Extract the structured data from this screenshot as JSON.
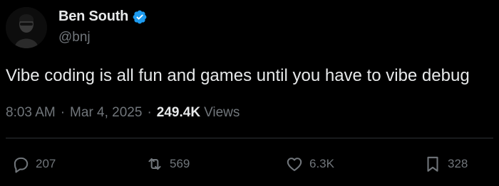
{
  "author": {
    "display_name": "Ben South",
    "handle": "@bnj",
    "verified_icon": "verified-badge-icon",
    "verified_color": "#1d9bf0",
    "avatar_icon": "avatar"
  },
  "post": {
    "text": "Vibe coding is all fun and games until you have to vibe debug"
  },
  "meta": {
    "time": "8:03 AM",
    "date": "Mar 4, 2025",
    "separator": "·",
    "views_count": "249.4K",
    "views_label": "Views"
  },
  "actions": {
    "reply": {
      "icon": "reply-icon",
      "count": "207"
    },
    "repost": {
      "icon": "repost-icon",
      "count": "569"
    },
    "like": {
      "icon": "heart-icon",
      "count": "6.3K"
    },
    "bookmark": {
      "icon": "bookmark-icon",
      "count": "328"
    }
  },
  "colors": {
    "background": "#000000",
    "primary_text": "#e7e9ea",
    "secondary_text": "#71767b",
    "divider": "#2f3336"
  }
}
